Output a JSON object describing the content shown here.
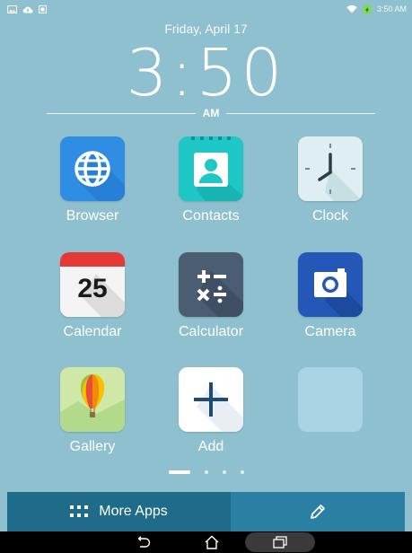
{
  "status_bar": {
    "time": "3:50 AM",
    "icons": [
      "image-icon",
      "cloud-upload-icon",
      "sim-icon",
      "wifi-icon",
      "battery-charging-icon"
    ]
  },
  "clock_widget": {
    "date": "Friday, April 17",
    "time": "3:50",
    "ampm": "AM"
  },
  "apps": [
    {
      "label": "Browser",
      "icon": "globe-icon",
      "color": "#2f8de4"
    },
    {
      "label": "Contacts",
      "icon": "person-icon",
      "color": "#1ec6c6"
    },
    {
      "label": "Clock",
      "icon": "clock-face-icon",
      "color": "#dfeff1"
    },
    {
      "label": "Calendar",
      "icon": "calendar-icon",
      "day": "25",
      "color": "#e53935"
    },
    {
      "label": "Calculator",
      "icon": "calculator-icon",
      "color": "#4a5d73"
    },
    {
      "label": "Camera",
      "icon": "camera-icon",
      "color": "#2457b8"
    },
    {
      "label": "Gallery",
      "icon": "balloon-icon",
      "color": "#cfe8a8"
    },
    {
      "label": "Add",
      "icon": "plus-icon",
      "color": "#ffffff"
    },
    {
      "label": "",
      "icon": "empty-slot",
      "color": "#a7d3e3"
    }
  ],
  "page_indicator": {
    "pages": 4,
    "current": 1
  },
  "bottom_bar": {
    "more_apps_label": "More Apps"
  },
  "nav_bar": {
    "buttons": [
      "back-icon",
      "home-icon",
      "recents-icon"
    ]
  }
}
